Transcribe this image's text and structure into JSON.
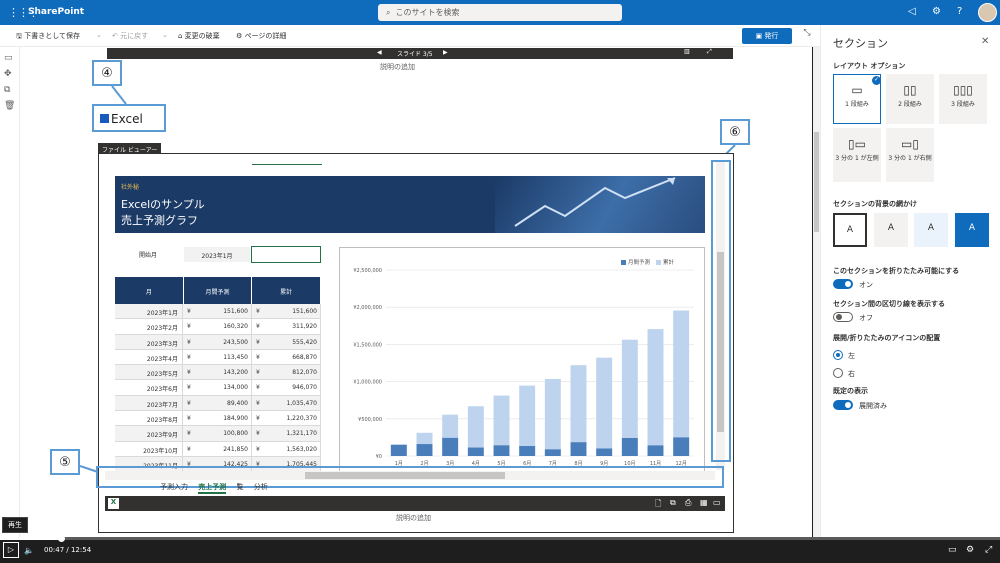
{
  "topbar": {
    "brand": "SharePoint",
    "waffle_icon": "waffle-icon",
    "search_placeholder": "このサイトを検索"
  },
  "cmdbar": {
    "save_draft": "下書きとして保存",
    "undo": "元に戻す",
    "discard": "変更の破棄",
    "page_details": "ページの詳細",
    "publish": "発行"
  },
  "slide": {
    "counter": "スライド 3/5",
    "caption": "説明の追加"
  },
  "callouts": {
    "c4": "④",
    "c5": "⑤",
    "c6": "⑥",
    "excel_label": "Excel"
  },
  "viewer": {
    "label": "ファイル ビューアー",
    "caption": "説明の追加"
  },
  "sheet": {
    "confidential": "社外秘",
    "title1": "Excelのサンプル",
    "title2": "売上予測グラフ",
    "start_label": "開始月",
    "start_value": "2023年1月",
    "headers": [
      "月",
      "月間予測",
      "累計"
    ],
    "currency": "¥",
    "rows": [
      {
        "m": "2023年1月",
        "v": "151,600",
        "c": "151,600"
      },
      {
        "m": "2023年2月",
        "v": "160,320",
        "c": "311,920"
      },
      {
        "m": "2023年3月",
        "v": "243,500",
        "c": "555,420"
      },
      {
        "m": "2023年4月",
        "v": "113,450",
        "c": "668,870"
      },
      {
        "m": "2023年5月",
        "v": "143,200",
        "c": "812,070"
      },
      {
        "m": "2023年6月",
        "v": "134,000",
        "c": "946,070"
      },
      {
        "m": "2023年7月",
        "v": "89,400",
        "c": "1,035,470"
      },
      {
        "m": "2023年8月",
        "v": "184,900",
        "c": "1,220,370"
      },
      {
        "m": "2023年9月",
        "v": "100,800",
        "c": "1,321,170"
      },
      {
        "m": "2023年10月",
        "v": "241,850",
        "c": "1,563,020"
      },
      {
        "m": "2023年11月",
        "v": "142,425",
        "c": "1,705,445"
      }
    ],
    "tabs": [
      "予測入力",
      "売上予測",
      "覧",
      "分析"
    ]
  },
  "chart_data": {
    "type": "bar",
    "categories": [
      "1月",
      "2月",
      "3月",
      "4月",
      "5月",
      "6月",
      "7月",
      "8月",
      "9月",
      "10月",
      "11月",
      "12月"
    ],
    "series": [
      {
        "name": "月間予測",
        "values": [
          151600,
          160320,
          243500,
          113450,
          143200,
          134000,
          89400,
          184900,
          100800,
          241850,
          142425,
          250000
        ]
      },
      {
        "name": "累計",
        "values": [
          151600,
          311920,
          555420,
          668870,
          812070,
          946070,
          1035470,
          1220370,
          1321170,
          1563020,
          1705445,
          1955445
        ]
      }
    ],
    "ylim": [
      0,
      2500000
    ],
    "yticks": [
      "¥2,500,000",
      "¥2,000,000",
      "¥1,500,000",
      "¥1,000,000",
      "¥500,000",
      "¥0"
    ],
    "colors": {
      "monthly": "#4a7ebb",
      "cumulative": "#bdd3ee"
    },
    "legend": "top-right"
  },
  "panel": {
    "title": "セクション",
    "layout_heading": "レイアウト オプション",
    "layouts": [
      {
        "label": "1 段組み",
        "icon": "one-column-icon"
      },
      {
        "label": "2 段組み",
        "icon": "two-column-icon"
      },
      {
        "label": "3 段組み",
        "icon": "three-column-icon"
      },
      {
        "label": "3 分の 1 が左側",
        "icon": "one-third-left-icon"
      },
      {
        "label": "3 分の 1 が右側",
        "icon": "one-third-right-icon"
      }
    ],
    "bg_heading": "セクションの背景の網かけ",
    "bg_glyph": "A",
    "collapse_heading": "このセクションを折りたたみ可能にする",
    "collapse_value": "オン",
    "divider_heading": "セクション間の区切り線を表示する",
    "divider_value": "オフ",
    "icon_pos_heading": "展開/折りたたみのアイコンの配置",
    "icon_pos_left": "左",
    "icon_pos_right": "右",
    "default_heading": "既定の表示",
    "default_value": "展開済み"
  },
  "player": {
    "tooltip": "再生",
    "time": "00:47 / 12:54",
    "progress": 0.061
  }
}
